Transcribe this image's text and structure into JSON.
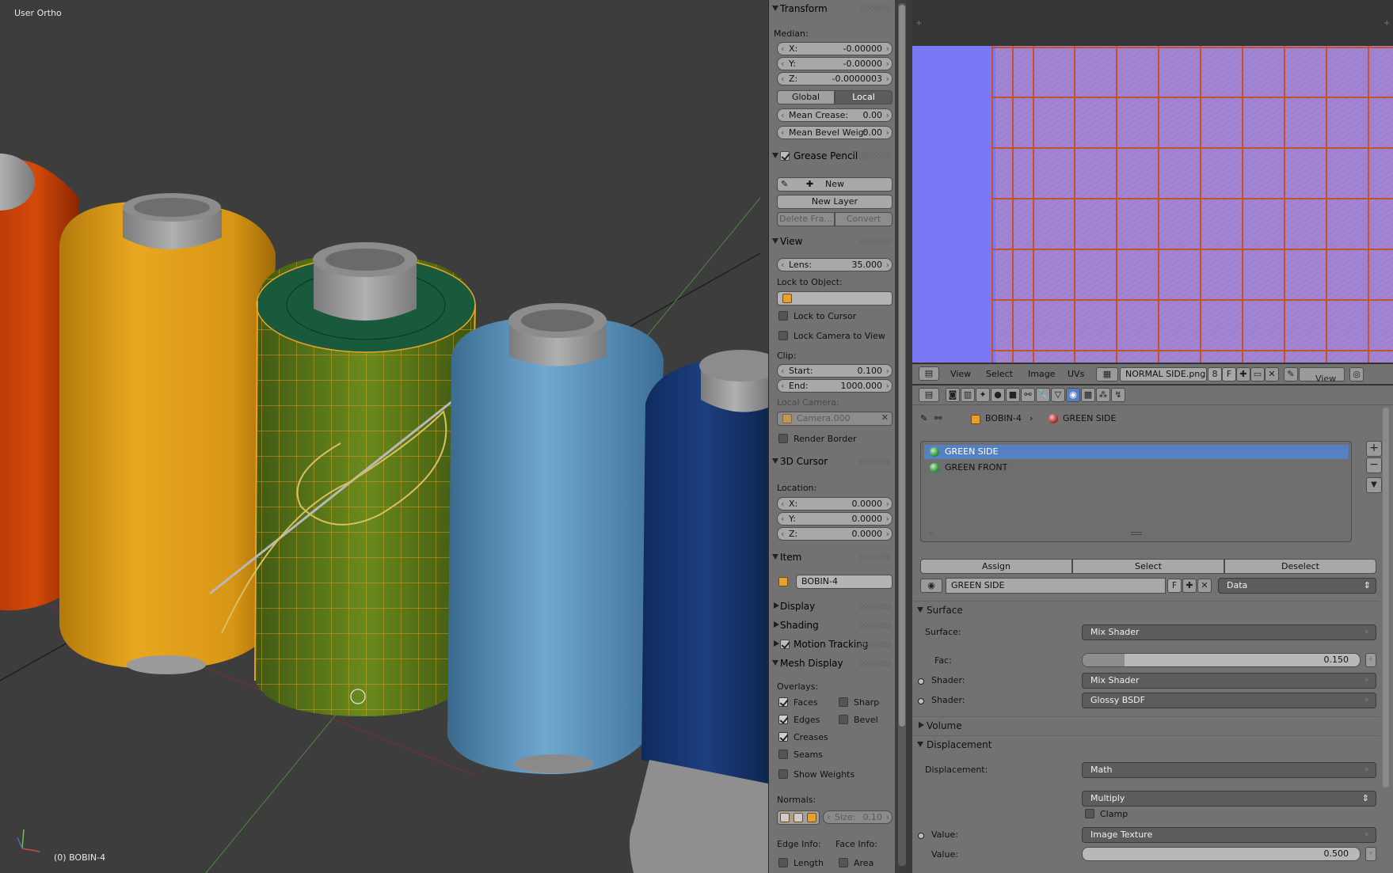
{
  "viewport": {
    "view_label": "User Ortho",
    "object_label": "(0) BOBIN-4"
  },
  "npanel": {
    "transform": {
      "title": "Transform",
      "median_label": "Median:",
      "x": {
        "k": "X:",
        "v": "-0.00000"
      },
      "y": {
        "k": "Y:",
        "v": "-0.00000"
      },
      "z": {
        "k": "Z:",
        "v": "-0.0000003"
      },
      "global": "Global",
      "local": "Local",
      "mean_crease": {
        "k": "Mean Crease:",
        "v": "0.00"
      },
      "mean_bevel": {
        "k": "Mean Bevel Weig:",
        "v": "0.00"
      }
    },
    "grease": {
      "title": "Grease Pencil",
      "new": "New",
      "new_layer": "New Layer",
      "delete_frame": "Delete Fra...",
      "convert": "Convert"
    },
    "view": {
      "title": "View",
      "lens": {
        "k": "Lens:",
        "v": "35.000"
      },
      "lock_to_object": "Lock to Object:",
      "lock_to_cursor": "Lock to Cursor",
      "lock_camera": "Lock Camera to View",
      "clip": "Clip:",
      "start": {
        "k": "Start:",
        "v": "0.100"
      },
      "end": {
        "k": "End:",
        "v": "1000.000"
      },
      "local_camera": "Local Camera:",
      "camera": "Camera.000",
      "render_border": "Render Border"
    },
    "cursor": {
      "title": "3D Cursor",
      "location": "Location:",
      "x": {
        "k": "X:",
        "v": "0.0000"
      },
      "y": {
        "k": "Y:",
        "v": "0.0000"
      },
      "z": {
        "k": "Z:",
        "v": "0.0000"
      }
    },
    "item": {
      "title": "Item",
      "name": "BOBIN-4"
    },
    "display": "Display",
    "shading": "Shading",
    "motion_tracking": "Motion Tracking",
    "mesh_display": {
      "title": "Mesh Display",
      "overlays": "Overlays:",
      "faces": "Faces",
      "sharp": "Sharp",
      "edges": "Edges",
      "bevel": "Bevel",
      "creases": "Creases",
      "seams": "Seams",
      "show_weights": "Show Weights",
      "normals": "Normals:",
      "size": {
        "k": "Size:",
        "v": "0.10"
      },
      "edge_info": "Edge Info:",
      "face_info": "Face Info:",
      "length": "Length",
      "area": "Area"
    }
  },
  "image_editor": {
    "menu": [
      "View",
      "Select",
      "Image",
      "UVs"
    ],
    "image_name": "NORMAL SIDE.png",
    "users": "8",
    "fake": "F",
    "view_menu": "View"
  },
  "properties": {
    "object": "BOBIN-4",
    "material": "GREEN SIDE",
    "slots": [
      "GREEN SIDE",
      "GREEN FRONT"
    ],
    "assign": "Assign",
    "select": "Select",
    "deselect": "Deselect",
    "mat_name": "GREEN SIDE",
    "fake": "F",
    "data": "Data",
    "surface": {
      "title": "Surface",
      "surface_label": "Surface:",
      "surface_value": "Mix Shader",
      "fac_label": "Fac:",
      "fac_value": "0.150",
      "shader1_label": "Shader:",
      "shader1_value": "Mix Shader",
      "shader2_label": "Shader:",
      "shader2_value": "Glossy BSDF"
    },
    "volume": "Volume",
    "displacement": {
      "title": "Displacement",
      "label": "Displacement:",
      "value": "Math",
      "operation": "Multiply",
      "clamp": "Clamp",
      "value1_label": "Value:",
      "value1": "Image Texture",
      "value2_label": "Value:",
      "value2": "0.500"
    }
  },
  "colors": {
    "viewport_bg": "#3d3d3d",
    "panel_bg": "#727272",
    "selection": "#5680c2",
    "uv_fill": "#9e82d0",
    "uv_lines": "#c8502a",
    "image_bg": "#7b78f5"
  }
}
